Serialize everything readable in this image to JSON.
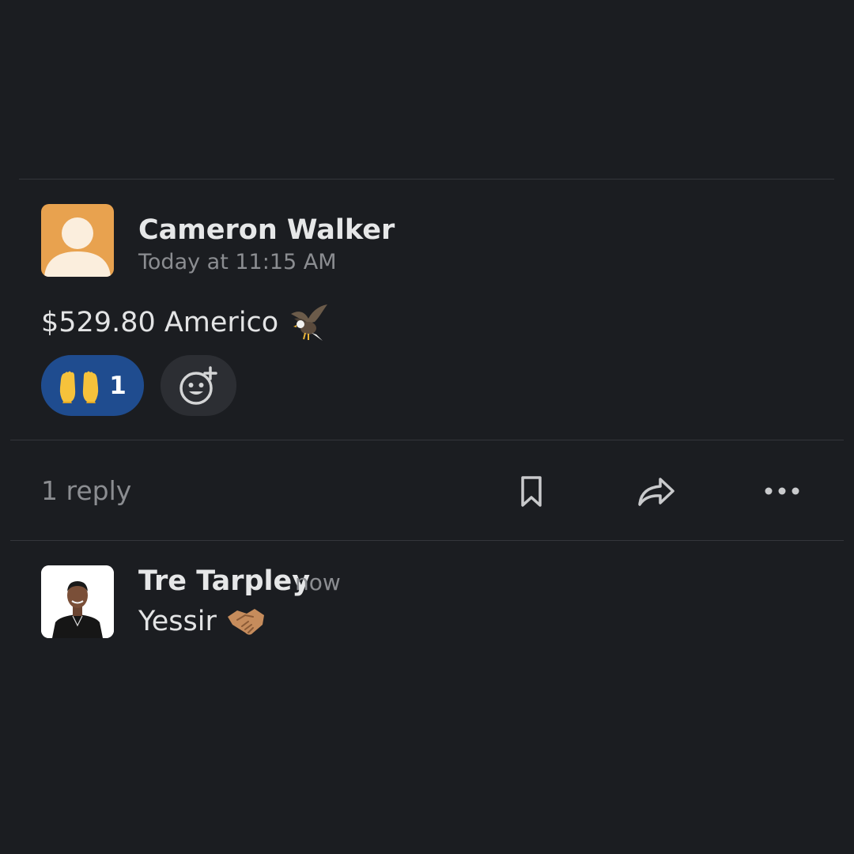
{
  "message": {
    "author": "Cameron Walker",
    "timestamp": "Today at 11:15 AM",
    "text": "$529.80 Americo",
    "emoji_icon": "eagle-icon",
    "avatar_icon": "default-user-avatar-icon",
    "avatar_color": "#e8a24f"
  },
  "reactions": [
    {
      "emoji": "raised-hands-icon",
      "count": "1",
      "color": "#1f4c8f"
    }
  ],
  "add_reaction_icon": "add-reaction-icon",
  "actions_bar": {
    "reply_count": "1 reply",
    "save_icon": "bookmark-icon",
    "share_icon": "share-arrow-icon",
    "more_icon": "more-icon"
  },
  "reply": {
    "author": "Tre Tarpley",
    "timestamp": "now",
    "text": "Yessir",
    "emoji_icon": "handshake-icon",
    "avatar_icon": "photo-avatar-icon"
  },
  "colors": {
    "background": "#1b1d21",
    "divider": "#34363b",
    "reaction_active": "#1f4c8f",
    "reaction_inactive": "#2c2e33",
    "muted_text": "#8b8d91"
  }
}
